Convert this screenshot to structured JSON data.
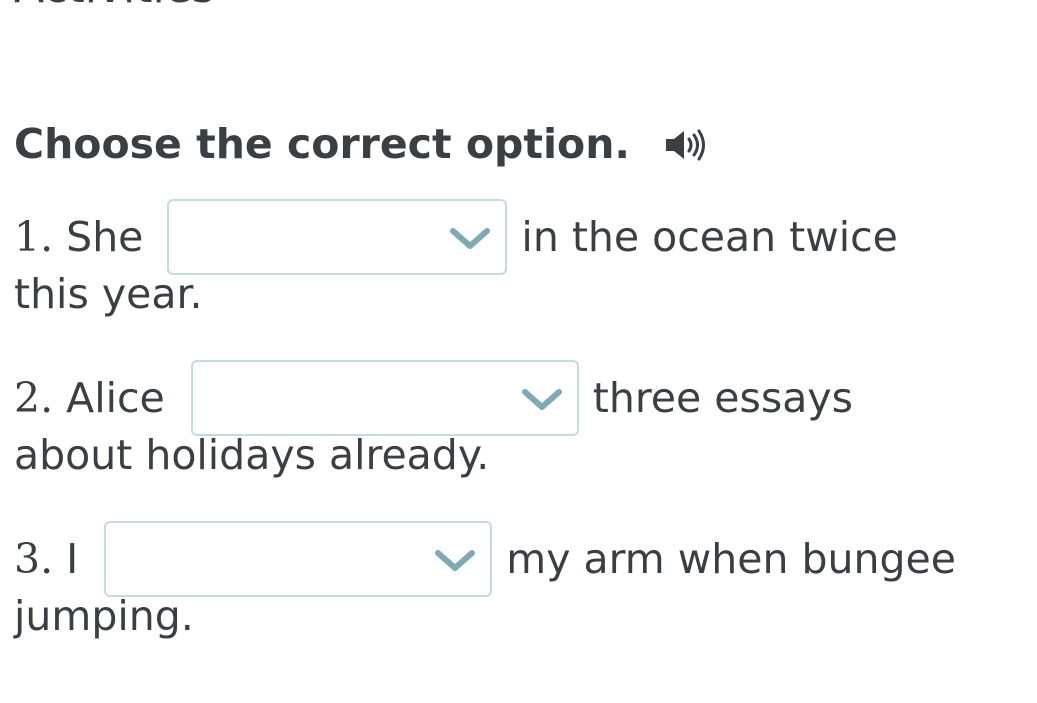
{
  "header": {
    "title": "Activities"
  },
  "instruction": {
    "text": "Choose the correct option.",
    "audio_icon": "speaker-icon"
  },
  "questions": [
    {
      "number": "1.",
      "before": "She",
      "after": "in the ocean twice",
      "continuation": "this year.",
      "selected": ""
    },
    {
      "number": "2.",
      "before": "Alice",
      "after": "three essays",
      "continuation": "about holidays already.",
      "selected": ""
    },
    {
      "number": "3.",
      "before": "I",
      "after": "my arm when bungee",
      "continuation": "jumping.",
      "selected": ""
    }
  ],
  "colors": {
    "text": "#3a3f44",
    "dropdown_border": "#c3dbe1",
    "chevron": "#7fa9b4"
  }
}
